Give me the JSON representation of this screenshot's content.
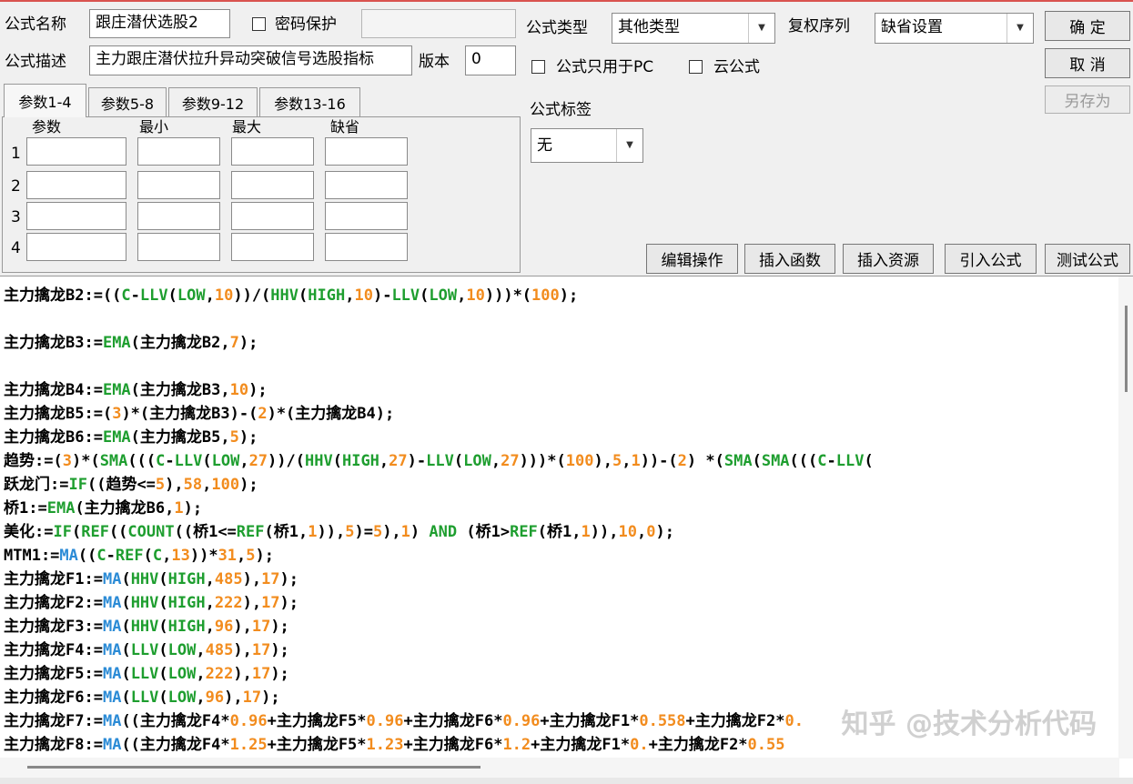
{
  "form": {
    "formula_name_label": "公式名称",
    "formula_name_value": "跟庄潜伏选股2",
    "password_label": "密码保护",
    "password_value": "",
    "formula_desc_label": "公式描述",
    "formula_desc_value": "主力跟庄潜伏拉升异动突破信号选股指标",
    "version_label": "版本",
    "version_value": "0",
    "formula_type_label": "公式类型",
    "formula_type_value": "其他类型",
    "rights_label": "复权序列",
    "rights_value": "缺省设置",
    "pc_only_label": "公式只用于PC",
    "cloud_label": "云公式",
    "tag_label": "公式标签",
    "tag_value": "无"
  },
  "buttons": {
    "ok": "确 定",
    "cancel": "取 消",
    "save_as": "另存为",
    "edit_ops": "编辑操作",
    "insert_func": "插入函数",
    "insert_resource": "插入资源",
    "import_formula": "引入公式",
    "test_formula": "测试公式"
  },
  "tabs": [
    "参数1-4",
    "参数5-8",
    "参数9-12",
    "参数13-16"
  ],
  "params": {
    "headers": [
      "参数",
      "最小",
      "最大",
      "缺省"
    ],
    "rows": [
      "1",
      "2",
      "3",
      "4"
    ]
  },
  "code_lines": [
    [
      [
        "主力擒龙B2:=((",
        "k"
      ],
      [
        "C",
        "f"
      ],
      [
        "-",
        "k"
      ],
      [
        "LLV",
        "f"
      ],
      [
        "(",
        "k"
      ],
      [
        "LOW",
        "f"
      ],
      [
        ",",
        "k"
      ],
      [
        "10",
        "n"
      ],
      [
        "))/(",
        "k"
      ],
      [
        "HHV",
        "f"
      ],
      [
        "(",
        "k"
      ],
      [
        "HIGH",
        "f"
      ],
      [
        ",",
        "k"
      ],
      [
        "10",
        "n"
      ],
      [
        ")-",
        "k"
      ],
      [
        "LLV",
        "f"
      ],
      [
        "(",
        "k"
      ],
      [
        "LOW",
        "f"
      ],
      [
        ",",
        "k"
      ],
      [
        "10",
        "n"
      ],
      [
        ")))*(",
        "k"
      ],
      [
        "100",
        "n"
      ],
      [
        ");",
        "k"
      ]
    ],
    [],
    [
      [
        "主力擒龙B3:=",
        "k"
      ],
      [
        "EMA",
        "f"
      ],
      [
        "(主力擒龙B2,",
        "k"
      ],
      [
        "7",
        "n"
      ],
      [
        ");",
        "k"
      ]
    ],
    [],
    [
      [
        "主力擒龙B4:=",
        "k"
      ],
      [
        "EMA",
        "f"
      ],
      [
        "(主力擒龙B3,",
        "k"
      ],
      [
        "10",
        "n"
      ],
      [
        ");",
        "k"
      ]
    ],
    [
      [
        "主力擒龙B5:=(",
        "k"
      ],
      [
        "3",
        "n"
      ],
      [
        ")*(主力擒龙B3)-(",
        "k"
      ],
      [
        "2",
        "n"
      ],
      [
        ")*(主力擒龙B4);",
        "k"
      ]
    ],
    [
      [
        "主力擒龙B6:=",
        "k"
      ],
      [
        "EMA",
        "f"
      ],
      [
        "(主力擒龙B5,",
        "k"
      ],
      [
        "5",
        "n"
      ],
      [
        ");",
        "k"
      ]
    ],
    [
      [
        "趋势:=(",
        "k"
      ],
      [
        "3",
        "n"
      ],
      [
        ")*(",
        "k"
      ],
      [
        "SMA",
        "f"
      ],
      [
        "(((",
        "k"
      ],
      [
        "C",
        "f"
      ],
      [
        "-",
        "k"
      ],
      [
        "LLV",
        "f"
      ],
      [
        "(",
        "k"
      ],
      [
        "LOW",
        "f"
      ],
      [
        ",",
        "k"
      ],
      [
        "27",
        "n"
      ],
      [
        "))/(",
        "k"
      ],
      [
        "HHV",
        "f"
      ],
      [
        "(",
        "k"
      ],
      [
        "HIGH",
        "f"
      ],
      [
        ",",
        "k"
      ],
      [
        "27",
        "n"
      ],
      [
        ")-",
        "k"
      ],
      [
        "LLV",
        "f"
      ],
      [
        "(",
        "k"
      ],
      [
        "LOW",
        "f"
      ],
      [
        ",",
        "k"
      ],
      [
        "27",
        "n"
      ],
      [
        ")))*(",
        "k"
      ],
      [
        "100",
        "n"
      ],
      [
        "),",
        "k"
      ],
      [
        "5",
        "n"
      ],
      [
        ",",
        "k"
      ],
      [
        "1",
        "n"
      ],
      [
        "))-(",
        "k"
      ],
      [
        "2",
        "n"
      ],
      [
        ") *(",
        "k"
      ],
      [
        "SMA",
        "f"
      ],
      [
        "(",
        "k"
      ],
      [
        "SMA",
        "f"
      ],
      [
        "(((",
        "k"
      ],
      [
        "C",
        "f"
      ],
      [
        "-",
        "k"
      ],
      [
        "LLV",
        "f"
      ],
      [
        "(",
        "k"
      ]
    ],
    [
      [
        "跃龙门:=",
        "k"
      ],
      [
        "IF",
        "f"
      ],
      [
        "((趋势<=",
        "k"
      ],
      [
        "5",
        "n"
      ],
      [
        "),",
        "k"
      ],
      [
        "58",
        "n"
      ],
      [
        ",",
        "k"
      ],
      [
        "100",
        "n"
      ],
      [
        ");",
        "k"
      ]
    ],
    [
      [
        "桥1:=",
        "k"
      ],
      [
        "EMA",
        "f"
      ],
      [
        "(主力擒龙B6,",
        "k"
      ],
      [
        "1",
        "n"
      ],
      [
        ");",
        "k"
      ]
    ],
    [
      [
        "美化:=",
        "k"
      ],
      [
        "IF",
        "f"
      ],
      [
        "(",
        "k"
      ],
      [
        "REF",
        "f"
      ],
      [
        "((",
        "k"
      ],
      [
        "COUNT",
        "f"
      ],
      [
        "((桥1<=",
        "k"
      ],
      [
        "REF",
        "f"
      ],
      [
        "(桥1,",
        "k"
      ],
      [
        "1",
        "n"
      ],
      [
        ")),",
        "k"
      ],
      [
        "5",
        "n"
      ],
      [
        ")=",
        "k"
      ],
      [
        "5",
        "n"
      ],
      [
        "),",
        "k"
      ],
      [
        "1",
        "n"
      ],
      [
        ") ",
        "k"
      ],
      [
        "AND",
        "f"
      ],
      [
        " (桥1>",
        "k"
      ],
      [
        "REF",
        "f"
      ],
      [
        "(桥1,",
        "k"
      ],
      [
        "1",
        "n"
      ],
      [
        ")),",
        "k"
      ],
      [
        "10",
        "n"
      ],
      [
        ",",
        "k"
      ],
      [
        "0",
        "n"
      ],
      [
        ");",
        "k"
      ]
    ],
    [
      [
        "MTM1:=",
        "k"
      ],
      [
        "MA",
        "fb"
      ],
      [
        "((",
        "k"
      ],
      [
        "C",
        "f"
      ],
      [
        "-",
        "k"
      ],
      [
        "REF",
        "f"
      ],
      [
        "(",
        "k"
      ],
      [
        "C",
        "f"
      ],
      [
        ",",
        "k"
      ],
      [
        "13",
        "n"
      ],
      [
        "))*",
        "k"
      ],
      [
        "31",
        "n"
      ],
      [
        ",",
        "k"
      ],
      [
        "5",
        "n"
      ],
      [
        ");",
        "k"
      ]
    ],
    [
      [
        "主力擒龙F1:=",
        "k"
      ],
      [
        "MA",
        "fb"
      ],
      [
        "(",
        "k"
      ],
      [
        "HHV",
        "f"
      ],
      [
        "(",
        "k"
      ],
      [
        "HIGH",
        "f"
      ],
      [
        ",",
        "k"
      ],
      [
        "485",
        "n"
      ],
      [
        "),",
        "k"
      ],
      [
        "17",
        "n"
      ],
      [
        ");",
        "k"
      ]
    ],
    [
      [
        "主力擒龙F2:=",
        "k"
      ],
      [
        "MA",
        "fb"
      ],
      [
        "(",
        "k"
      ],
      [
        "HHV",
        "f"
      ],
      [
        "(",
        "k"
      ],
      [
        "HIGH",
        "f"
      ],
      [
        ",",
        "k"
      ],
      [
        "222",
        "n"
      ],
      [
        "),",
        "k"
      ],
      [
        "17",
        "n"
      ],
      [
        ");",
        "k"
      ]
    ],
    [
      [
        "主力擒龙F3:=",
        "k"
      ],
      [
        "MA",
        "fb"
      ],
      [
        "(",
        "k"
      ],
      [
        "HHV",
        "f"
      ],
      [
        "(",
        "k"
      ],
      [
        "HIGH",
        "f"
      ],
      [
        ",",
        "k"
      ],
      [
        "96",
        "n"
      ],
      [
        "),",
        "k"
      ],
      [
        "17",
        "n"
      ],
      [
        ");",
        "k"
      ]
    ],
    [
      [
        "主力擒龙F4:=",
        "k"
      ],
      [
        "MA",
        "fb"
      ],
      [
        "(",
        "k"
      ],
      [
        "LLV",
        "f"
      ],
      [
        "(",
        "k"
      ],
      [
        "LOW",
        "f"
      ],
      [
        ",",
        "k"
      ],
      [
        "485",
        "n"
      ],
      [
        "),",
        "k"
      ],
      [
        "17",
        "n"
      ],
      [
        ");",
        "k"
      ]
    ],
    [
      [
        "主力擒龙F5:=",
        "k"
      ],
      [
        "MA",
        "fb"
      ],
      [
        "(",
        "k"
      ],
      [
        "LLV",
        "f"
      ],
      [
        "(",
        "k"
      ],
      [
        "LOW",
        "f"
      ],
      [
        ",",
        "k"
      ],
      [
        "222",
        "n"
      ],
      [
        "),",
        "k"
      ],
      [
        "17",
        "n"
      ],
      [
        ");",
        "k"
      ]
    ],
    [
      [
        "主力擒龙F6:=",
        "k"
      ],
      [
        "MA",
        "fb"
      ],
      [
        "(",
        "k"
      ],
      [
        "LLV",
        "f"
      ],
      [
        "(",
        "k"
      ],
      [
        "LOW",
        "f"
      ],
      [
        ",",
        "k"
      ],
      [
        "96",
        "n"
      ],
      [
        "),",
        "k"
      ],
      [
        "17",
        "n"
      ],
      [
        ");",
        "k"
      ]
    ],
    [
      [
        "主力擒龙F7:=",
        "k"
      ],
      [
        "MA",
        "fb"
      ],
      [
        "((主力擒龙F4*",
        "k"
      ],
      [
        "0.96",
        "n"
      ],
      [
        "+主力擒龙F5*",
        "k"
      ],
      [
        "0.96",
        "n"
      ],
      [
        "+主力擒龙F6*",
        "k"
      ],
      [
        "0.96",
        "n"
      ],
      [
        "+主力擒龙F1*",
        "k"
      ],
      [
        "0.558",
        "n"
      ],
      [
        "+主力擒龙F2*",
        "k"
      ],
      [
        "0.",
        "n"
      ]
    ],
    [
      [
        "主力擒龙F8:=",
        "k"
      ],
      [
        "MA",
        "fb"
      ],
      [
        "((主力擒龙F4*",
        "k"
      ],
      [
        "1.25",
        "n"
      ],
      [
        "+主力擒龙F5*",
        "k"
      ],
      [
        "1.23",
        "n"
      ],
      [
        "+主力擒龙F6*",
        "k"
      ],
      [
        "1.2",
        "n"
      ],
      [
        "+主力擒龙F1*",
        "k"
      ],
      [
        "0.",
        "n"
      ],
      [
        "+主力擒龙F2*",
        "k"
      ],
      [
        "0.55",
        "n"
      ]
    ]
  ],
  "watermark": "知乎 @技术分析代码"
}
